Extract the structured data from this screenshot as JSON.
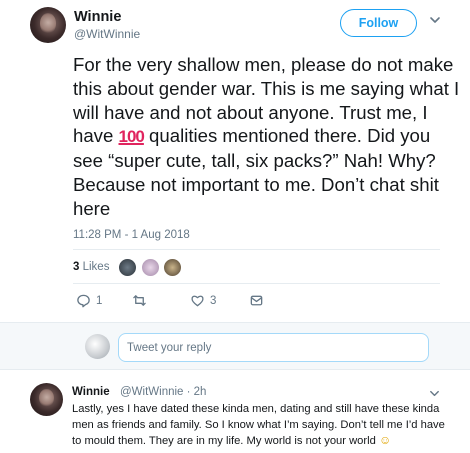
{
  "tweet": {
    "author_name": "Winnie",
    "author_handle": "@WitWinnie",
    "follow_label": "Follow",
    "text_part1": "For the very shallow men, please do not make this about gender war. This is me saying what I will have and not about anyone. Trust me, I have ",
    "emoji_100": "100",
    "text_part2": " qualities mentioned there. Did you see “super cute, tall, six packs?” Nah! Why? Because not important to me. Don’t chat shit here",
    "timestamp": "11:28 PM - 1 Aug 2018",
    "likes_number": "3",
    "likes_label": "Likes"
  },
  "actions": {
    "reply_count": "1",
    "retweet_count": "",
    "like_count": "3"
  },
  "reply_box": {
    "placeholder": "Tweet your reply"
  },
  "reply": {
    "author_name": "Winnie",
    "meta": "@WitWinnie · 2h",
    "text": "Lastly, yes I have dated these kinda men, dating  and still have these kinda men as friends and family. So I know what I’m saying. Don’t tell me I’d have to mould them. They are in my life. My world is not your world",
    "emoji": "☺"
  },
  "colors": {
    "accent": "#1da1f2",
    "secondary_text": "#657786",
    "divider": "#e6ecf0"
  },
  "icons": [
    "chevron-down-icon",
    "reply-icon",
    "retweet-icon",
    "heart-icon",
    "direct-message-icon"
  ]
}
